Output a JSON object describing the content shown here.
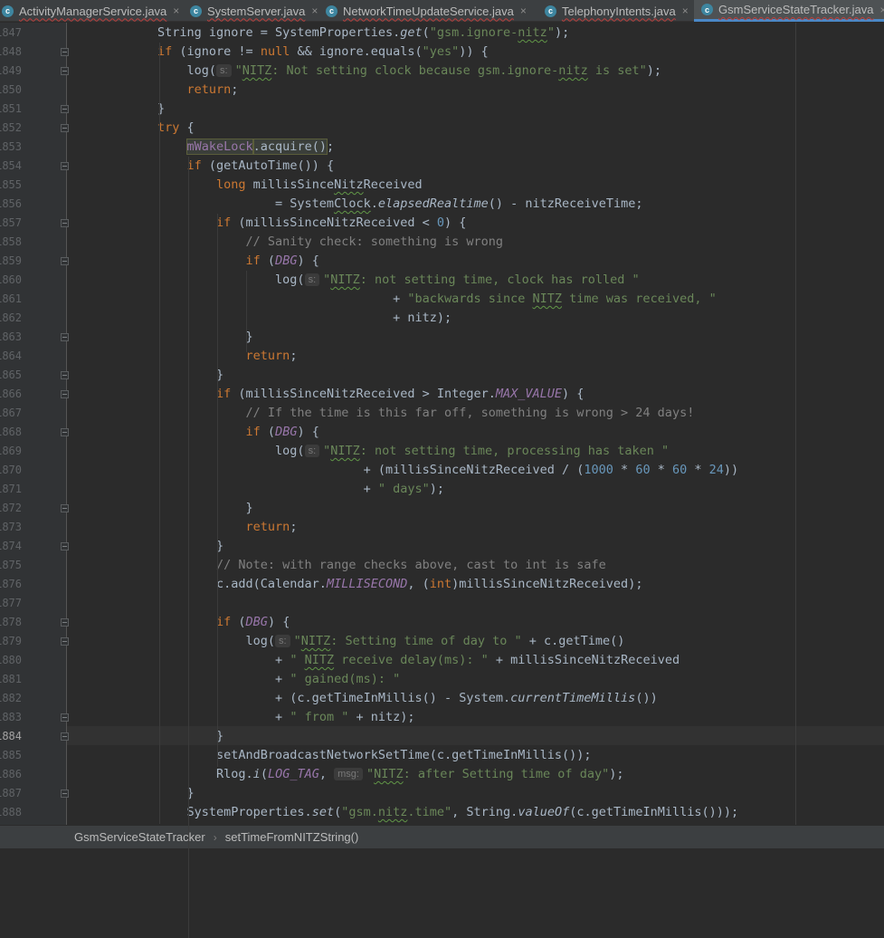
{
  "tabs": [
    {
      "label": "ActivityManagerService.java",
      "icon": "class-icon",
      "active": false
    },
    {
      "label": "SystemServer.java",
      "icon": "class-icon",
      "active": false
    },
    {
      "label": "NetworkTimeUpdateService.java",
      "icon": "class-icon",
      "active": false
    },
    {
      "label": "TelephonyIntents.java",
      "icon": "class-icon",
      "active": false
    },
    {
      "label": "GsmServiceStateTracker.java",
      "icon": "class-icon",
      "active": true
    }
  ],
  "tab_close_glyph": "×",
  "current_line": "1884",
  "lines": [
    {
      "n": "1847",
      "tokens": [
        [
          "p",
          "String ignore = SystemProperties."
        ],
        [
          "it",
          "get"
        ],
        [
          "p",
          "("
        ],
        [
          "s",
          "\"gsm.ignore-"
        ],
        [
          "sw",
          "nitz"
        ],
        [
          "s",
          "\""
        ],
        [
          "p",
          ");"
        ]
      ]
    },
    {
      "n": "1848",
      "tokens": [
        [
          "k",
          "if"
        ],
        [
          "p",
          " (ignore != "
        ],
        [
          "k",
          "null"
        ],
        [
          "p",
          " && ignore.equals("
        ],
        [
          "s",
          "\"yes\""
        ],
        [
          "p",
          ")) {"
        ]
      ]
    },
    {
      "n": "1849",
      "tokens": [
        [
          "p",
          "    log("
        ],
        [
          "h",
          "s:"
        ],
        [
          "s",
          "\""
        ],
        [
          "sw",
          "NITZ"
        ],
        [
          "s",
          ": Not setting clock because gsm.ignore-"
        ],
        [
          "sw",
          "nitz"
        ],
        [
          "s",
          " is set\""
        ],
        [
          "p",
          ");"
        ]
      ]
    },
    {
      "n": "1850",
      "tokens": [
        [
          "k",
          "    return"
        ],
        [
          "p",
          ";"
        ]
      ]
    },
    {
      "n": "1851",
      "tokens": [
        [
          "p",
          "}"
        ]
      ]
    },
    {
      "n": "1852",
      "tokens": [
        [
          "k",
          "try"
        ],
        [
          "p",
          " {"
        ]
      ]
    },
    {
      "n": "1853",
      "tokens": [
        [
          "p",
          "    "
        ],
        [
          "fh",
          "mWakeLock"
        ],
        [
          "ph",
          ".acquire()"
        ],
        [
          "p",
          ";"
        ]
      ]
    },
    {
      "n": "1854",
      "tokens": [
        [
          "k",
          "    if"
        ],
        [
          "p",
          " (getAutoTime()) {"
        ]
      ]
    },
    {
      "n": "1855",
      "tokens": [
        [
          "k",
          "        long"
        ],
        [
          "p",
          " millisSince"
        ],
        [
          "pw",
          "Nitz"
        ],
        [
          "p",
          "Received"
        ]
      ]
    },
    {
      "n": "1856",
      "tokens": [
        [
          "p",
          "                = System"
        ],
        [
          "pw",
          "Clock"
        ],
        [
          "p",
          "."
        ],
        [
          "it",
          "elapsedRealtime"
        ],
        [
          "p",
          "() - nitzReceiveTime;"
        ]
      ]
    },
    {
      "n": "1857",
      "tokens": [
        [
          "k",
          "        if"
        ],
        [
          "p",
          " (millisSinceNitzReceived < "
        ],
        [
          "n",
          "0"
        ],
        [
          "p",
          ") {"
        ]
      ]
    },
    {
      "n": "1858",
      "tokens": [
        [
          "c",
          "            // Sanity check: something is wrong"
        ]
      ]
    },
    {
      "n": "1859",
      "tokens": [
        [
          "k",
          "            if"
        ],
        [
          "p",
          " ("
        ],
        [
          "cn",
          "DBG"
        ],
        [
          "p",
          ") {"
        ]
      ]
    },
    {
      "n": "1860",
      "tokens": [
        [
          "p",
          "                log("
        ],
        [
          "h",
          "s:"
        ],
        [
          "s",
          "\""
        ],
        [
          "sw",
          "NITZ"
        ],
        [
          "s",
          ": not setting time, clock has rolled \""
        ]
      ]
    },
    {
      "n": "1861",
      "tokens": [
        [
          "p",
          "                                + "
        ],
        [
          "s",
          "\"backwards since "
        ],
        [
          "sw",
          "NITZ"
        ],
        [
          "s",
          " time was received, \""
        ]
      ]
    },
    {
      "n": "1862",
      "tokens": [
        [
          "p",
          "                                + nitz);"
        ]
      ]
    },
    {
      "n": "1863",
      "tokens": [
        [
          "p",
          "            }"
        ]
      ]
    },
    {
      "n": "1864",
      "tokens": [
        [
          "k",
          "            return"
        ],
        [
          "p",
          ";"
        ]
      ]
    },
    {
      "n": "1865",
      "tokens": [
        [
          "p",
          "        }"
        ]
      ]
    },
    {
      "n": "1866",
      "tokens": [
        [
          "k",
          "        if"
        ],
        [
          "p",
          " (millisSinceNitzReceived > Integer."
        ],
        [
          "cn",
          "MAX_VALUE"
        ],
        [
          "p",
          ") {"
        ]
      ]
    },
    {
      "n": "1867",
      "tokens": [
        [
          "c",
          "            // If the time is this far off, something is wrong > 24 days!"
        ]
      ]
    },
    {
      "n": "1868",
      "tokens": [
        [
          "k",
          "            if"
        ],
        [
          "p",
          " ("
        ],
        [
          "cn",
          "DBG"
        ],
        [
          "p",
          ") {"
        ]
      ]
    },
    {
      "n": "1869",
      "tokens": [
        [
          "p",
          "                log("
        ],
        [
          "h",
          "s:"
        ],
        [
          "s",
          "\""
        ],
        [
          "sw",
          "NITZ"
        ],
        [
          "s",
          ": not setting time, processing has taken \""
        ]
      ]
    },
    {
      "n": "1870",
      "tokens": [
        [
          "p",
          "                            + (millisSinceNitzReceived / ("
        ],
        [
          "n",
          "1000"
        ],
        [
          "p",
          " * "
        ],
        [
          "n",
          "60"
        ],
        [
          "p",
          " * "
        ],
        [
          "n",
          "60"
        ],
        [
          "p",
          " * "
        ],
        [
          "n",
          "24"
        ],
        [
          "p",
          "))"
        ]
      ]
    },
    {
      "n": "1871",
      "tokens": [
        [
          "p",
          "                            + "
        ],
        [
          "s",
          "\" days\""
        ],
        [
          "p",
          ");"
        ]
      ]
    },
    {
      "n": "1872",
      "tokens": [
        [
          "p",
          "            }"
        ]
      ]
    },
    {
      "n": "1873",
      "tokens": [
        [
          "k",
          "            return"
        ],
        [
          "p",
          ";"
        ]
      ]
    },
    {
      "n": "1874",
      "tokens": [
        [
          "p",
          "        }"
        ]
      ]
    },
    {
      "n": "1875",
      "tokens": [
        [
          "c",
          "        // Note: with range checks above, cast to int is safe"
        ]
      ]
    },
    {
      "n": "1876",
      "tokens": [
        [
          "p",
          "        c.add(Calendar."
        ],
        [
          "cn",
          "MILLISECOND"
        ],
        [
          "p",
          ", ("
        ],
        [
          "k",
          "int"
        ],
        [
          "p",
          ")millisSinceNitzReceived);"
        ]
      ]
    },
    {
      "n": "1877",
      "tokens": []
    },
    {
      "n": "1878",
      "tokens": [
        [
          "k",
          "        if"
        ],
        [
          "p",
          " ("
        ],
        [
          "cn",
          "DBG"
        ],
        [
          "p",
          ") {"
        ]
      ]
    },
    {
      "n": "1879",
      "tokens": [
        [
          "p",
          "            log("
        ],
        [
          "h",
          "s:"
        ],
        [
          "s",
          "\""
        ],
        [
          "sw",
          "NITZ"
        ],
        [
          "s",
          ": Setting time of day to \""
        ],
        [
          "p",
          " + c.getTime()"
        ]
      ]
    },
    {
      "n": "1880",
      "tokens": [
        [
          "p",
          "                + "
        ],
        [
          "s",
          "\" "
        ],
        [
          "sw",
          "NITZ"
        ],
        [
          "s",
          " receive delay(ms): \""
        ],
        [
          "p",
          " + millisSinceNitzReceived"
        ]
      ]
    },
    {
      "n": "1881",
      "tokens": [
        [
          "p",
          "                + "
        ],
        [
          "s",
          "\" gained(ms): \""
        ]
      ]
    },
    {
      "n": "1882",
      "tokens": [
        [
          "p",
          "                + (c.getTimeInMillis() - System."
        ],
        [
          "it",
          "currentTimeMillis"
        ],
        [
          "p",
          "())"
        ]
      ]
    },
    {
      "n": "1883",
      "tokens": [
        [
          "p",
          "                + "
        ],
        [
          "s",
          "\" from \""
        ],
        [
          "p",
          " + nitz);"
        ]
      ]
    },
    {
      "n": "1884",
      "tokens": [
        [
          "p",
          "        }"
        ]
      ]
    },
    {
      "n": "1885",
      "tokens": [
        [
          "p",
          "        setAndBroadcastNetworkSetTime(c.getTimeInMillis());"
        ]
      ]
    },
    {
      "n": "1886",
      "tokens": [
        [
          "p",
          "        Rlog."
        ],
        [
          "it",
          "i"
        ],
        [
          "p",
          "("
        ],
        [
          "cn",
          "LOG_TAG"
        ],
        [
          "p",
          ", "
        ],
        [
          "h",
          "msg:"
        ],
        [
          "s",
          "\""
        ],
        [
          "sw",
          "NITZ"
        ],
        [
          "s",
          ": after Setting time of day\""
        ],
        [
          "p",
          ");"
        ]
      ]
    },
    {
      "n": "1887",
      "tokens": [
        [
          "p",
          "    }"
        ]
      ]
    },
    {
      "n": "1888",
      "tokens": [
        [
          "p",
          "    SystemProperties."
        ],
        [
          "it",
          "set"
        ],
        [
          "p",
          "("
        ],
        [
          "s",
          "\"gsm."
        ],
        [
          "sw",
          "nitz"
        ],
        [
          "s",
          ".time\""
        ],
        [
          "p",
          ", String."
        ],
        [
          "it",
          "valueOf"
        ],
        [
          "p",
          "(c.getTimeInMillis()));"
        ]
      ]
    }
  ],
  "breadcrumb": {
    "class_name": "GsmServiceStateTracker",
    "separator": "›",
    "method_name": "setTimeFromNITZString()"
  },
  "colors": {
    "background": "#2b2b2b",
    "gutter": "#313335",
    "keyword": "#cc7832",
    "string": "#6a8759",
    "number": "#6897bb",
    "comment": "#808080",
    "constant": "#9876aa",
    "plain": "#a9b7c6"
  }
}
